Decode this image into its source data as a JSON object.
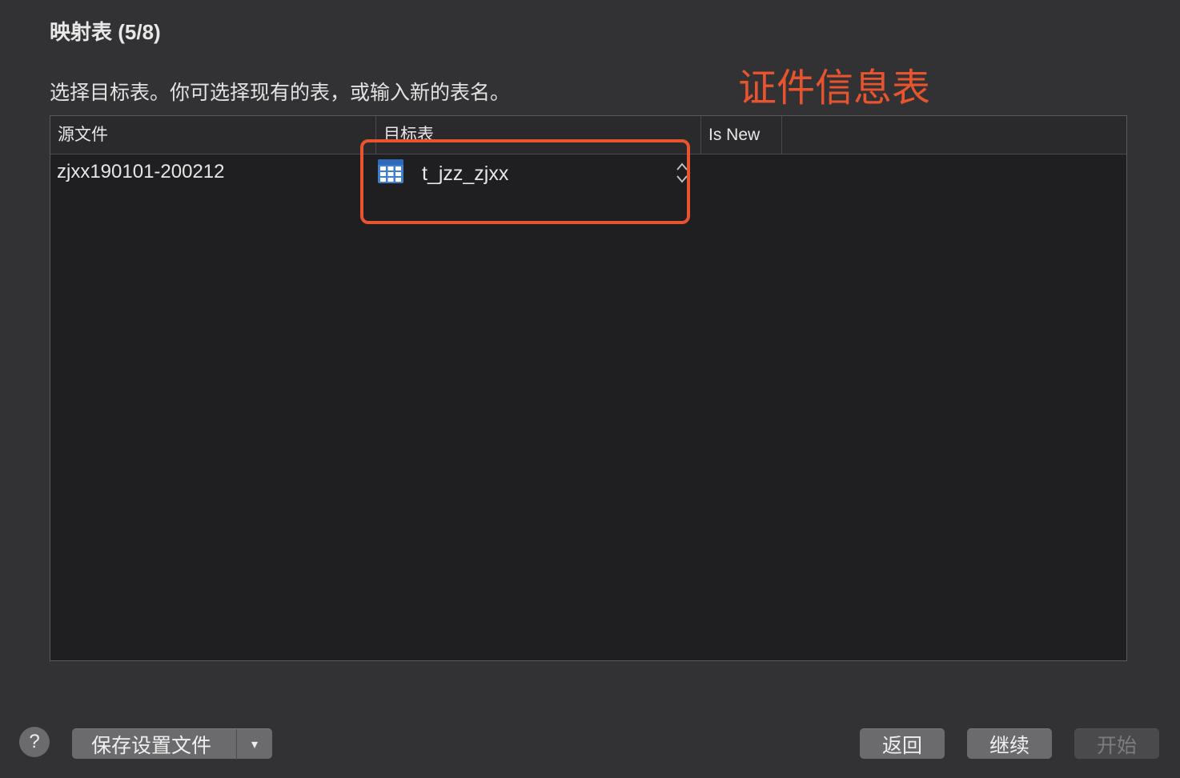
{
  "dialog": {
    "title": "映射表 (5/8)",
    "instruction": "选择目标表。你可选择现有的表，或输入新的表名。"
  },
  "annotation": {
    "text": "证件信息表",
    "color": "#e8542e"
  },
  "table": {
    "columns": [
      "源文件",
      "目标表",
      "Is New"
    ],
    "rows": [
      {
        "source": "zjxx190101-200212",
        "target": "t_jzz_zjxx",
        "target_icon": "table-grid-icon"
      }
    ]
  },
  "footer": {
    "help_label": "?",
    "save_settings_label": "保存设置文件",
    "save_dropdown_label": "▾",
    "back_label": "返回",
    "continue_label": "继续",
    "start_label": "开始"
  }
}
